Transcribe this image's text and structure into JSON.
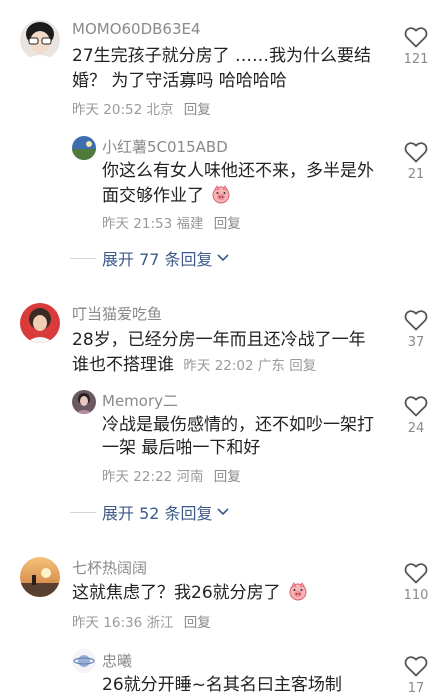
{
  "comments": [
    {
      "username": "MOMO60DB63E4",
      "text_lines": [
        "27生完孩子就分房了 ……我为什么要结",
        "婚？ 为了守活寡吗 哈哈哈哈"
      ],
      "time": "昨天 20:52",
      "location": "北京",
      "reply_label": "回复",
      "likes": "121",
      "reply": {
        "username": "小红薯5C015ABD",
        "text_lines": [
          "你这么有女人味他还不来，多半是外",
          "面交够作业了"
        ],
        "time": "昨天 21:53",
        "location": "福建",
        "reply_label": "回复",
        "likes": "21"
      },
      "expand_label": "展开 77 条回复"
    },
    {
      "username": "叮当猫爱吃鱼",
      "text_lines": [
        "28岁，已经分房一年而且还冷战了一年",
        "谁也不搭理谁"
      ],
      "time": "昨天 22:02",
      "location": "广东",
      "reply_label": "回复",
      "likes": "37",
      "reply": {
        "username": "Memory二",
        "text_lines": [
          "冷战是最伤感情的，还不如吵一架打",
          "一架 最后啪一下和好"
        ],
        "time": "昨天 22:22",
        "location": "河南",
        "reply_label": "回复",
        "likes": "24"
      },
      "expand_label": "展开 52 条回复"
    },
    {
      "username": "七杯热阔阔",
      "text_lines": [
        "这就焦虑了？我26就分房了"
      ],
      "time": "昨天 16:36",
      "location": "浙江",
      "reply_label": "回复",
      "likes": "110",
      "reply": {
        "username": "忠曦",
        "text_lines": [
          "26就分开睡~名其名曰主客场制"
        ],
        "likes": "17"
      }
    }
  ],
  "icons": {
    "like": "heart-outline-icon",
    "expand": "chevron-down-icon",
    "emoji": "pig-face-emoji-icon"
  },
  "colors": {
    "link": "#3d5a8a",
    "muted": "#8a8a8a",
    "text": "#222222"
  }
}
